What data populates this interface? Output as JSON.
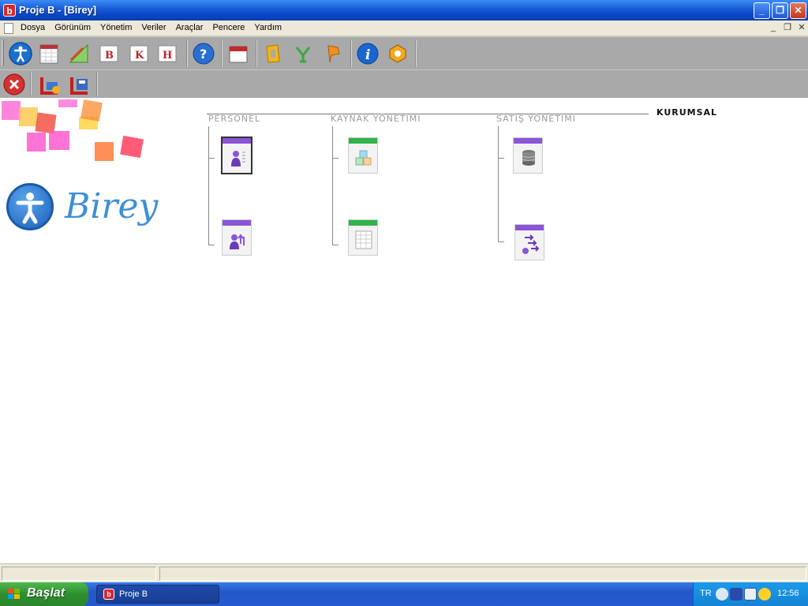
{
  "window": {
    "title": "Proje B - [Birey]",
    "app_icon_letter": "b"
  },
  "menu": {
    "items": [
      "Dosya",
      "Görünüm",
      "Yönetim",
      "Veriler",
      "Araçlar",
      "Pencere",
      "Yardım"
    ]
  },
  "toolbar1": {
    "buttons": [
      {
        "name": "accessibility-icon"
      },
      {
        "name": "calendar-sheet-icon"
      },
      {
        "name": "ruler-triangle-icon"
      },
      {
        "name": "b-card-icon",
        "letter": "B"
      },
      {
        "name": "k-card-icon",
        "letter": "K"
      },
      {
        "name": "h-card-icon",
        "letter": "H"
      },
      {
        "name": "help-globe-icon"
      },
      {
        "name": "calendar-icon"
      },
      {
        "name": "office-o-icon"
      },
      {
        "name": "network-icon"
      },
      {
        "name": "pointer-icon"
      },
      {
        "name": "info-icon"
      },
      {
        "name": "hexagon-icon"
      }
    ]
  },
  "toolbar2": {
    "buttons": [
      {
        "name": "close-red-icon"
      },
      {
        "name": "folder-load-icon"
      },
      {
        "name": "disk-save-icon"
      }
    ]
  },
  "brand": {
    "logo_text": "Birey"
  },
  "sections": {
    "corporate_label": "KURUMSAL",
    "personel": "PERSONEL",
    "kaynak": "KAYNAK YÖNETİMİ",
    "satis": "SATIŞ YÖNETİMİ"
  },
  "colors": {
    "accent": "#3d8fd6",
    "titlebar": "#0a46c8",
    "toolbar": "#a9a9a9",
    "purple_tab": "#8a55d6",
    "green_tab": "#2fb34a"
  },
  "taskbar": {
    "start_label": "Başlat",
    "task_label": "Proje B",
    "lang": "TR",
    "clock": "12:56"
  }
}
